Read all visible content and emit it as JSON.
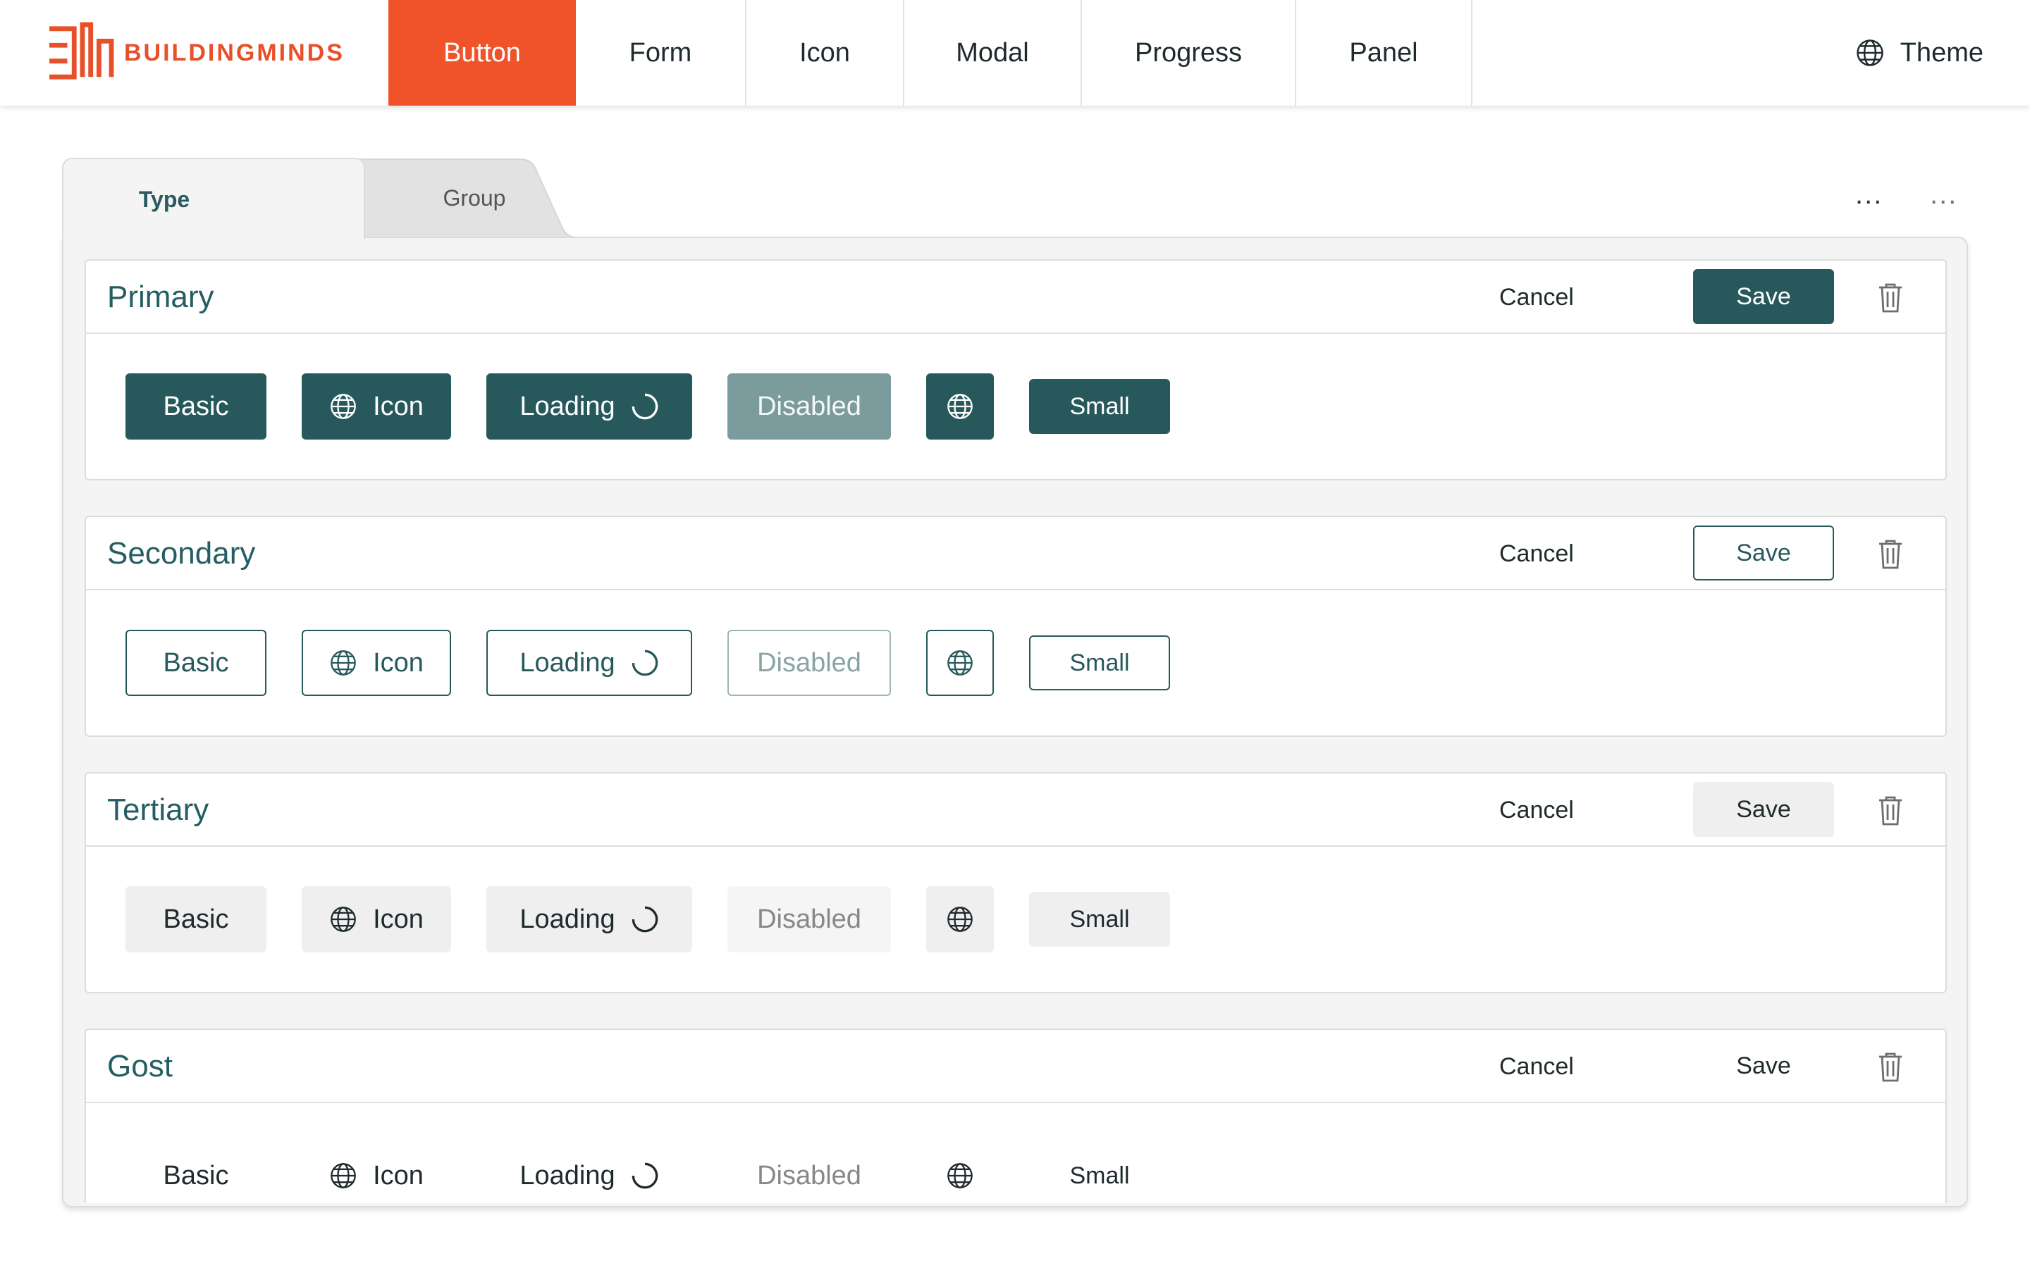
{
  "header": {
    "brand": "BUILDINGMINDS",
    "nav": [
      "Button",
      "Form",
      "Icon",
      "Modal",
      "Progress",
      "Panel"
    ],
    "active_nav": "Button",
    "theme_label": "Theme",
    "brand_color": "#f0522a"
  },
  "tabs": {
    "items": [
      "Type",
      "Group"
    ],
    "active": "Type",
    "more_1": "...",
    "more_2": "..."
  },
  "panels": [
    {
      "title": "Primary",
      "cancel": "Cancel",
      "save": "Save",
      "buttons": {
        "basic": "Basic",
        "icon": "Icon",
        "loading": "Loading",
        "disabled": "Disabled",
        "small": "Small"
      }
    },
    {
      "title": "Secondary",
      "cancel": "Cancel",
      "save": "Save",
      "buttons": {
        "basic": "Basic",
        "icon": "Icon",
        "loading": "Loading",
        "disabled": "Disabled",
        "small": "Small"
      }
    },
    {
      "title": "Tertiary",
      "cancel": "Cancel",
      "save": "Save",
      "buttons": {
        "basic": "Basic",
        "icon": "Icon",
        "loading": "Loading",
        "disabled": "Disabled",
        "small": "Small"
      }
    },
    {
      "title": "Gost",
      "cancel": "Cancel",
      "save": "Save",
      "buttons": {
        "basic": "Basic",
        "icon": "Icon",
        "loading": "Loading",
        "disabled": "Disabled",
        "small": "Small"
      }
    }
  ],
  "colors": {
    "accent": "#27595c",
    "brand": "#f0522a"
  }
}
